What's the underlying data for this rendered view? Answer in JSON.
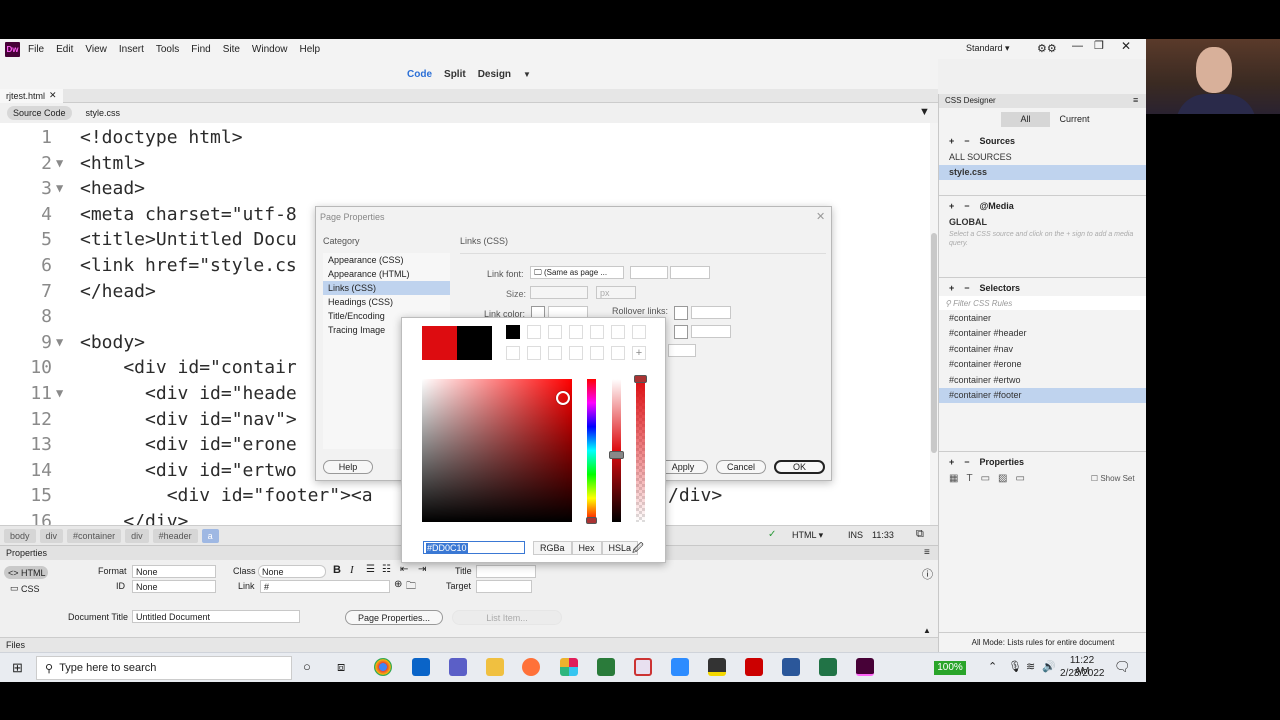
{
  "app": {
    "logo": "Dw",
    "menu": [
      "File",
      "Edit",
      "View",
      "Insert",
      "Tools",
      "Find",
      "Site",
      "Window",
      "Help"
    ],
    "workspace": "Standard",
    "views": {
      "code": "Code",
      "split": "Split",
      "design": "Design"
    }
  },
  "tabs": {
    "file": "rjtest.html",
    "source": "Source Code",
    "related": "style.css"
  },
  "code_lines": [
    {
      "n": "1",
      "t": "<!doctype html>"
    },
    {
      "n": "2",
      "t": "<html>"
    },
    {
      "n": "3",
      "t": "<head>"
    },
    {
      "n": "4",
      "t": "<meta charset=\"utf-8"
    },
    {
      "n": "5",
      "t": "<title>Untitled Docu"
    },
    {
      "n": "6",
      "t": "<link href=\"style.cs"
    },
    {
      "n": "7",
      "t": "</head>"
    },
    {
      "n": "8",
      "t": ""
    },
    {
      "n": "9",
      "t": "<body>"
    },
    {
      "n": "10",
      "t": "    <div id=\"contair"
    },
    {
      "n": "11",
      "t": "      <div id=\"heade"
    },
    {
      "n": "12",
      "t": "      <div id=\"nav\">"
    },
    {
      "n": "13",
      "t": "      <div id=\"erone"
    },
    {
      "n": "14",
      "t": "      <div id=\"ertwo"
    },
    {
      "n": "15",
      "t": "        <div id=\"footer\"><a"
    },
    {
      "n": "16",
      "t": "    </div>"
    }
  ],
  "code_line15_tail": "/div>",
  "status": {
    "crumbs": [
      "body",
      "div",
      "#container",
      "div",
      "#header",
      "a"
    ],
    "mode": "HTML",
    "ins": "INS",
    "pos": "11:33"
  },
  "properties": {
    "title": "Properties",
    "html": "HTML",
    "css": "CSS",
    "format_label": "Format",
    "format_value": "None",
    "class_label": "Class",
    "class_value": "None",
    "id_label": "ID",
    "id_value": "None",
    "link_label": "Link",
    "link_value": "#",
    "title_label": "Title",
    "target_label": "Target",
    "doc_title_label": "Document Title",
    "doc_title_value": "Untitled Document",
    "page_props_btn": "Page Properties...",
    "list_item_btn": "List Item..."
  },
  "files_label": "Files",
  "css_designer": {
    "title": "CSS Designer",
    "all": "All",
    "current": "Current",
    "sources": "Sources",
    "all_sources": "ALL SOURCES",
    "style_css": "style.css",
    "media": "@Media",
    "global": "GLOBAL",
    "media_hint": "Select a CSS source and click on the + sign to add a media query.",
    "selectors": "Selectors",
    "filter_placeholder": "Filter CSS Rules",
    "selector_items": [
      "#container",
      "#container #header",
      "#container #nav",
      "#container #erone",
      "#container #ertwo",
      "#container #footer"
    ],
    "properties": "Properties",
    "show_set": "Show Set",
    "footer": "All Mode: Lists rules for entire document"
  },
  "dialog": {
    "title": "Page Properties",
    "category": "Category",
    "categories": [
      "Appearance (CSS)",
      "Appearance (HTML)",
      "Links (CSS)",
      "Headings (CSS)",
      "Title/Encoding",
      "Tracing Image"
    ],
    "section": "Links (CSS)",
    "link_font_label": "Link font:",
    "link_font_value": "(Same as page ...",
    "size_label": "Size:",
    "size_unit": "px",
    "link_color_label": "Link color:",
    "rollover_label": "Rollover links:",
    "help": "Help",
    "apply": "Apply",
    "cancel": "Cancel",
    "ok": "OK"
  },
  "color_picker": {
    "hex_value": "#DD0C10",
    "modes": [
      "RGBa",
      "Hex",
      "HSLa"
    ],
    "current_color": "#dd0c10",
    "previous_color": "#000000"
  },
  "taskbar": {
    "search_placeholder": "Type here to search",
    "battery": "100%",
    "time": "11:22 AM",
    "date": "2/23/2022"
  }
}
